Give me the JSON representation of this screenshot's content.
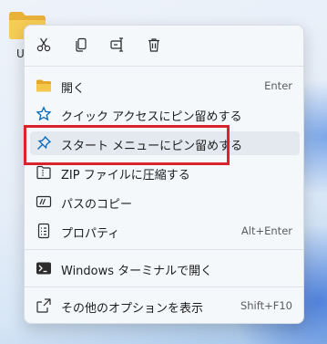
{
  "desktop": {
    "folder_label": "U"
  },
  "menu": {
    "quick_actions": [
      {
        "name": "cut-icon"
      },
      {
        "name": "copy-icon"
      },
      {
        "name": "rename-icon"
      },
      {
        "name": "delete-icon"
      }
    ],
    "items": [
      {
        "label": "開く",
        "shortcut": "Enter",
        "icon": "folder-icon"
      },
      {
        "label": "クイック アクセスにピン留めする",
        "shortcut": "",
        "icon": "star-icon"
      },
      {
        "label": "スタート メニューにピン留めする",
        "shortcut": "",
        "icon": "pin-icon"
      },
      {
        "label": "ZIP ファイルに圧縮する",
        "shortcut": "",
        "icon": "zip-icon"
      },
      {
        "label": "パスのコピー",
        "shortcut": "",
        "icon": "path-copy-icon"
      },
      {
        "label": "プロパティ",
        "shortcut": "Alt+Enter",
        "icon": "properties-icon"
      },
      {
        "label": "Windows ターミナルで開く",
        "shortcut": "",
        "icon": "terminal-icon"
      },
      {
        "label": "その他のオプションを表示",
        "shortcut": "Shift+F10",
        "icon": "more-options-icon"
      }
    ]
  },
  "colors": {
    "highlight": "#d9232d",
    "accent": "#0067c0",
    "menu_bg": "#f5f8fb"
  }
}
